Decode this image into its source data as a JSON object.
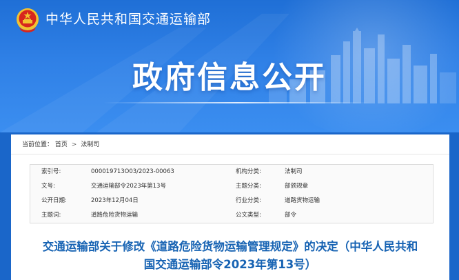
{
  "header": {
    "ministry_name": "中华人民共和国交通运输部",
    "hero_title": "政府信息公开"
  },
  "breadcrumb": {
    "prefix": "当前位置：",
    "items": [
      "首页",
      "法制司"
    ],
    "separator": ">"
  },
  "meta": {
    "rows": [
      {
        "label1": "索引号:",
        "value1": "000019713O03/2023-00063",
        "label2": "机构分类:",
        "value2": "法制司"
      },
      {
        "label1": "文号:",
        "value1": "交通运输部令2023年第13号",
        "label2": "主题分类:",
        "value2": "部颁规章"
      },
      {
        "label1": "公开日期:",
        "value1": "2023年12月04日",
        "label2": "行业分类:",
        "value2": "道路货物运输"
      },
      {
        "label1": "主题词:",
        "value1": "道路危险货物运输",
        "label2": "公文类型:",
        "value2": "部令"
      }
    ]
  },
  "document": {
    "title_line1": "交通运输部关于修改《道路危险货物运输管理规定》的决定（中华人民共和",
    "title_line2": "国交通运输部令2023年第13号）"
  },
  "colors": {
    "banner_blue": "#2f80e6",
    "title_blue": "#1763b3",
    "emblem_red": "#d7261e",
    "emblem_gold": "#f2c230"
  }
}
